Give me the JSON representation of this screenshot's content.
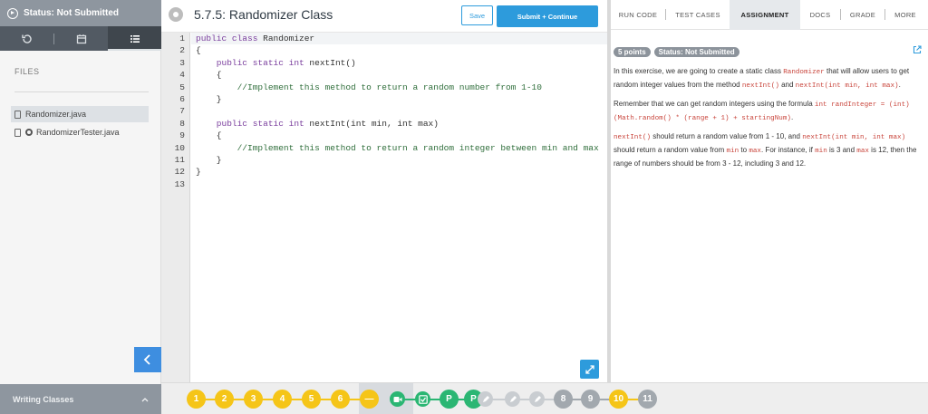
{
  "sidebar": {
    "status_label": "Status: Not Submitted",
    "files_heading": "FILES",
    "files": [
      "Randomizer.java",
      "RandomizerTester.java"
    ],
    "lesson_label": "Writing Classes"
  },
  "editor": {
    "title": "5.7.5: Randomizer Class",
    "save_label": "Save",
    "submit_label": "Submit + Continue",
    "line_numbers": [
      "1",
      "2",
      "3",
      "4",
      "5",
      "6",
      "7",
      "8",
      "9",
      "10",
      "11",
      "12",
      "13"
    ],
    "lines": [
      {
        "kw": "public class",
        "rest": " Randomizer"
      },
      {
        "text": "{"
      },
      {
        "kw": "    public static int",
        "rest": " nextInt()"
      },
      {
        "text": "    {"
      },
      {
        "comment": "        //Implement this method to return a random number from 1-10"
      },
      {
        "text": "    }"
      },
      {
        "text": ""
      },
      {
        "kw": "    public static int",
        "rest": " nextInt(int min, int max)"
      },
      {
        "text": "    {"
      },
      {
        "comment": "        //Implement this method to return a random integer between min and max"
      },
      {
        "text": "    }"
      },
      {
        "text": "}"
      },
      {
        "text": ""
      }
    ]
  },
  "nav_tabs": [
    "RUN CODE",
    "TEST CASES",
    "ASSIGNMENT",
    "DOCS",
    "GRADE",
    "MORE"
  ],
  "assignment": {
    "points_badge": "5 points",
    "status_badge": "Status: Not Submitted",
    "p1": {
      "a": "In this exercise, we are going to create a static class ",
      "code1": "Randomizer",
      "b": " that will allow users to get random integer values from the method ",
      "code2": "nextInt()",
      "c": " and ",
      "code3": "nextInt(int min, int max)",
      "d": "."
    },
    "p2": {
      "a": "Remember that we can get random integers using the formula ",
      "code1": "int randInteger = (int)(Math.random() * (range + 1) + startingNum)",
      "b": "."
    },
    "p3": {
      "code1": "nextInt()",
      "a": " should return a random value from 1 - 10, and ",
      "code2": "nextInt(int min, int max)",
      "b": " should return a random value from ",
      "code3": "min",
      "c": " to ",
      "code4": "max",
      "d": ". For instance, if ",
      "code5": "min",
      "e": " is 3 and ",
      "code6": "max",
      "f": " is 12, then the range of numbers should be from 3 - 12, including 3 and 12."
    }
  },
  "progress": {
    "steps": [
      {
        "label": "1",
        "color": "#f5c518"
      },
      {
        "label": "2",
        "color": "#f5c518"
      },
      {
        "label": "3",
        "color": "#f5c518"
      },
      {
        "label": "4",
        "color": "#f5c518"
      },
      {
        "label": "5",
        "color": "#f5c518"
      },
      {
        "label": "6",
        "color": "#f5c518"
      },
      {
        "label": "—",
        "color": "#f5c518"
      },
      {
        "label": "",
        "color": "#2bb673",
        "icon": "video-icon"
      },
      {
        "label": "",
        "color": "#2bb673",
        "icon": "check-icon"
      },
      {
        "label": "P",
        "color": "#2bb673"
      },
      {
        "label": "P",
        "color": "#2bb673"
      },
      {
        "label": "",
        "color": "#c9cdd1",
        "icon": "pencil-icon"
      },
      {
        "label": "",
        "color": "#c9cdd1",
        "icon": "pencil-icon"
      },
      {
        "label": "",
        "color": "#c9cdd1",
        "icon": "pencil-icon"
      },
      {
        "label": "8",
        "color": "#a2a8ae"
      },
      {
        "label": "9",
        "color": "#a2a8ae"
      },
      {
        "label": "10",
        "color": "#f5c518"
      },
      {
        "label": "11",
        "color": "#a2a8ae"
      }
    ]
  },
  "colors": {
    "accent": "#2d9bdc",
    "sidebar_header": "#8e969f",
    "complete": "#f5c518",
    "green": "#2bb673"
  }
}
